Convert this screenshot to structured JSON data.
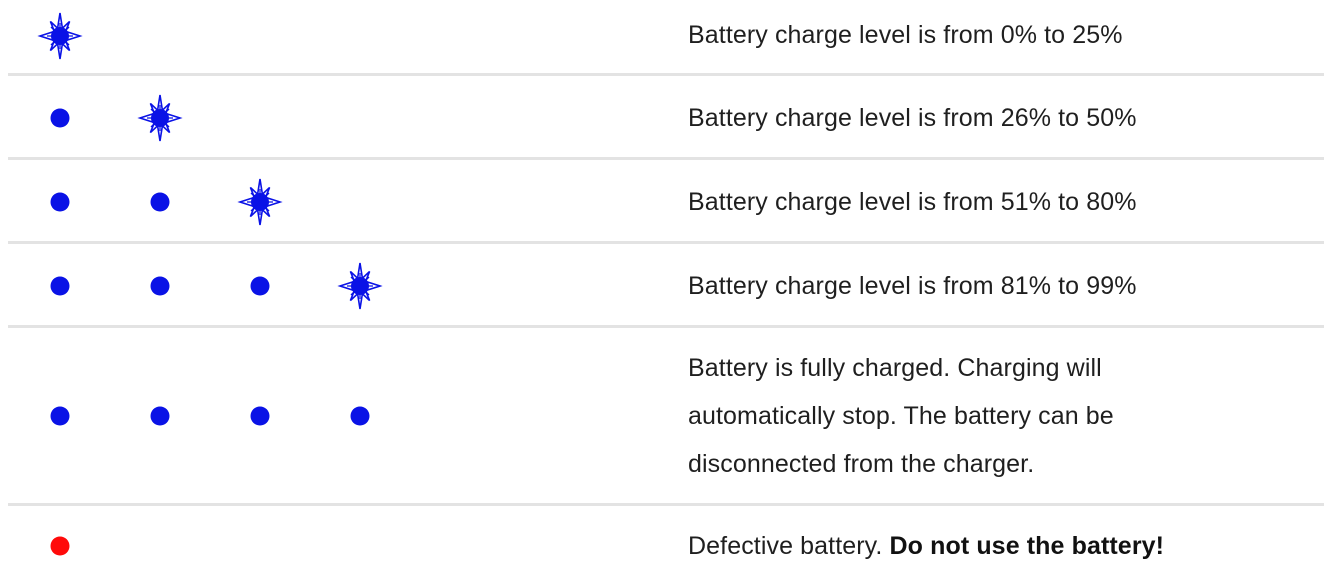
{
  "colors": {
    "led_blue": "#0a12e6",
    "led_red": "#ff0a0a",
    "divider": "#e3e3e3",
    "text": "#1f1f1f"
  },
  "legend": {
    "icons": {
      "steady": "filled-dot-icon",
      "flashing": "flashing-star-icon",
      "fault": "red-dot-icon"
    }
  },
  "rows": [
    {
      "leds": [
        "flashing"
      ],
      "description": "Battery charge level is from 0% to 25%"
    },
    {
      "leds": [
        "steady",
        "flashing"
      ],
      "description": "Battery charge level is from 26% to 50%"
    },
    {
      "leds": [
        "steady",
        "steady",
        "flashing"
      ],
      "description": "Battery charge level is from 51% to 80%"
    },
    {
      "leds": [
        "steady",
        "steady",
        "steady",
        "flashing"
      ],
      "description": "Battery charge level is from 81% to 99%"
    },
    {
      "leds": [
        "steady",
        "steady",
        "steady",
        "steady"
      ],
      "description_lines": [
        "Battery is fully charged. Charging will",
        "automatically stop. The battery can be",
        "disconnected from the charger."
      ]
    },
    {
      "leds": [
        "fault"
      ],
      "description": "Defective battery.",
      "description_emphasis": "Do not use the battery!"
    }
  ]
}
